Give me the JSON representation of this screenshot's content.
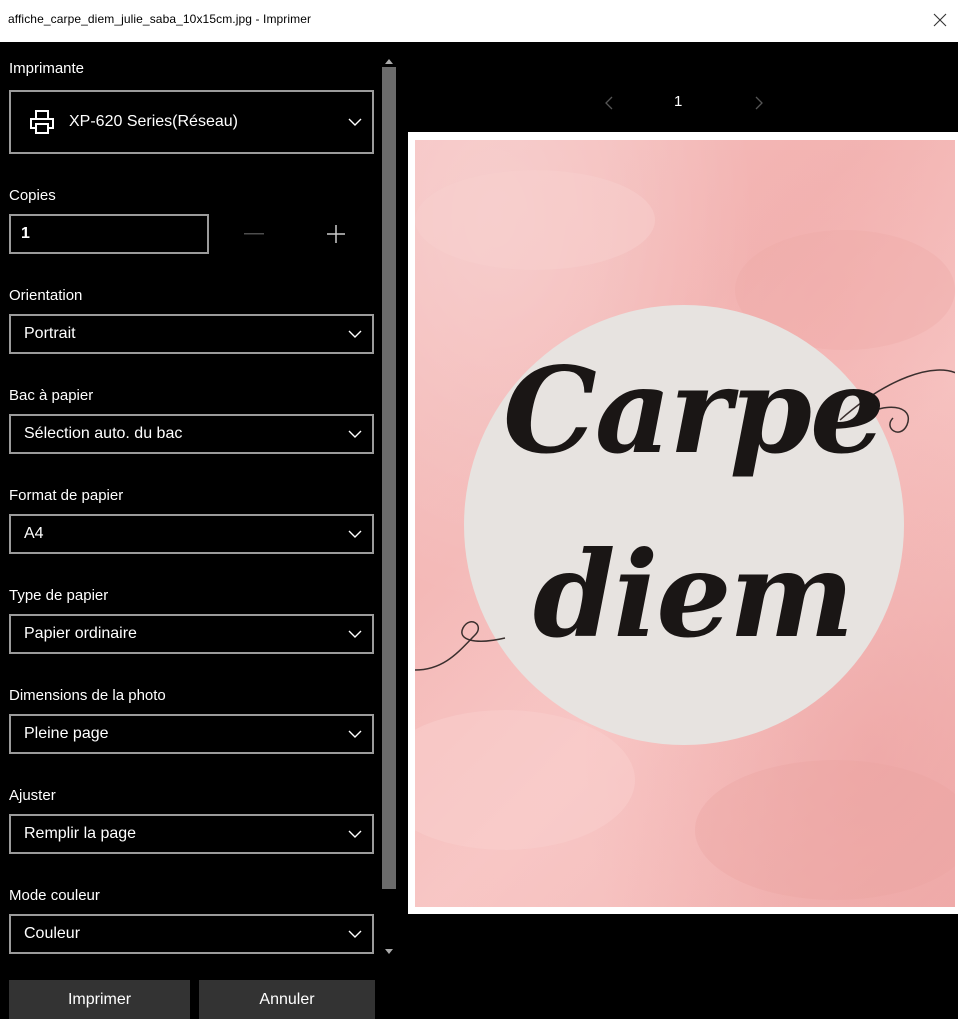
{
  "window": {
    "title": "affiche_carpe_diem_julie_saba_10x15cm.jpg - Imprimer"
  },
  "settings": {
    "printer": {
      "label": "Imprimante",
      "value": "XP-620 Series(Réseau)",
      "icon": "printer-icon"
    },
    "copies": {
      "label": "Copies",
      "value": "1"
    },
    "orientation": {
      "label": "Orientation",
      "value": "Portrait"
    },
    "paper_tray": {
      "label": "Bac à papier",
      "value": "Sélection auto. du bac"
    },
    "paper_size": {
      "label": "Format de papier",
      "value": "A4"
    },
    "paper_type": {
      "label": "Type de papier",
      "value": "Papier ordinaire"
    },
    "photo_size": {
      "label": "Dimensions de la photo",
      "value": "Pleine page"
    },
    "fit": {
      "label": "Ajuster",
      "value": "Remplir la page"
    },
    "color_mode": {
      "label": "Mode couleur",
      "value": "Couleur"
    }
  },
  "buttons": {
    "print": "Imprimer",
    "cancel": "Annuler"
  },
  "preview": {
    "page_number": "1",
    "image_text_line1": "Carpe",
    "image_text_line2": "diem"
  },
  "colors": {
    "background": "#000000",
    "border": "#9b9b9b",
    "button": "#333333",
    "scrollbar_thumb": "#6b6b6b",
    "poster_pink": "#f5c0bf",
    "poster_circle": "#e7e3e0",
    "poster_text": "#1a1615"
  }
}
